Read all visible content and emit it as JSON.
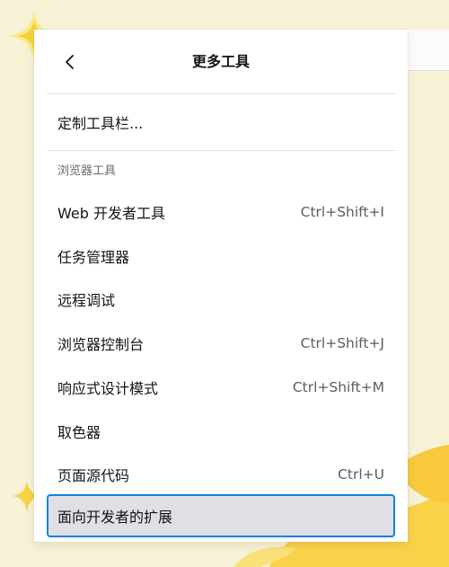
{
  "panel": {
    "back_icon": "chevron-left-icon",
    "title": "更多工具"
  },
  "customize": {
    "label": "定制工具栏..."
  },
  "browser_tools": {
    "section_label": "浏览器工具",
    "items": [
      {
        "label": "Web 开发者工具",
        "shortcut": "Ctrl+Shift+I"
      },
      {
        "label": "任务管理器",
        "shortcut": ""
      },
      {
        "label": "远程调试",
        "shortcut": ""
      },
      {
        "label": "浏览器控制台",
        "shortcut": "Ctrl+Shift+J"
      },
      {
        "label": "响应式设计模式",
        "shortcut": "Ctrl+Shift+M"
      },
      {
        "label": "取色器",
        "shortcut": ""
      },
      {
        "label": "页面源代码",
        "shortcut": "Ctrl+U"
      },
      {
        "label": "面向开发者的扩展",
        "shortcut": ""
      }
    ]
  },
  "colors": {
    "focus_ring": "#0a84e0",
    "focused_bg": "#e0dfe5",
    "background": "#f7f1d6",
    "accent_yellow": "#f7cf3a"
  }
}
